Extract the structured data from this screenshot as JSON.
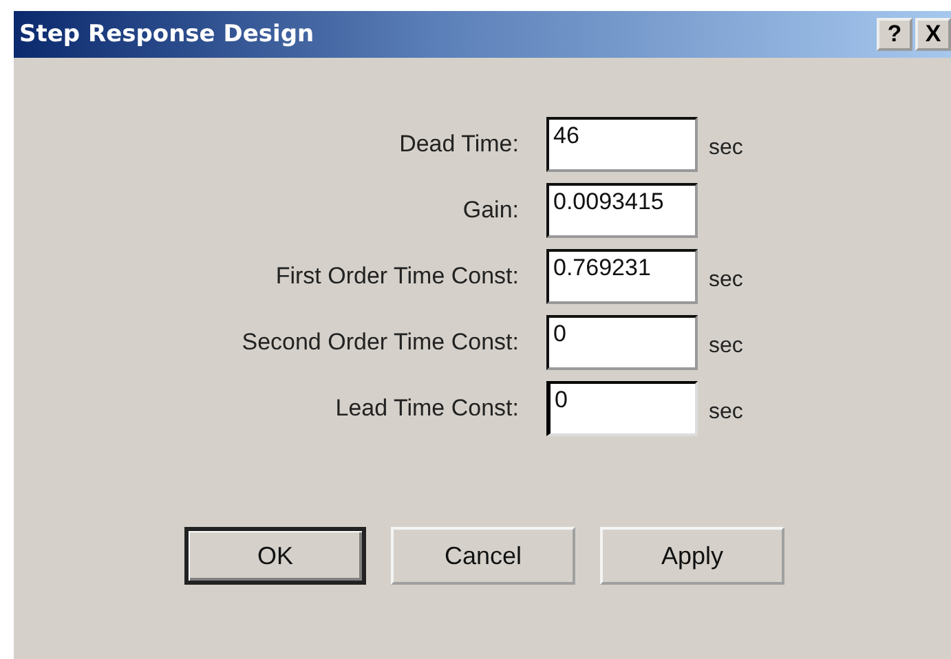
{
  "window": {
    "title": "Step Response Design",
    "title_buttons": [
      "?",
      "X"
    ]
  },
  "fields": [
    {
      "label": "Dead Time:",
      "value": "46",
      "unit": "sec",
      "focused": false
    },
    {
      "label": "Gain:",
      "value": "0.0093415",
      "focused": false
    },
    {
      "label": "First Order Time Const:",
      "value": "0.769231",
      "unit": "sec",
      "focused": false
    },
    {
      "label": "Second Order Time Const:",
      "value": "0",
      "unit": "sec",
      "focused": false
    },
    {
      "label": "Lead Time Const:",
      "value": "0",
      "unit": "sec",
      "focused": true
    }
  ],
  "buttons": [
    {
      "label": "OK",
      "default": true
    },
    {
      "label": "Cancel",
      "default": false
    },
    {
      "label": "Apply",
      "default": false
    }
  ]
}
